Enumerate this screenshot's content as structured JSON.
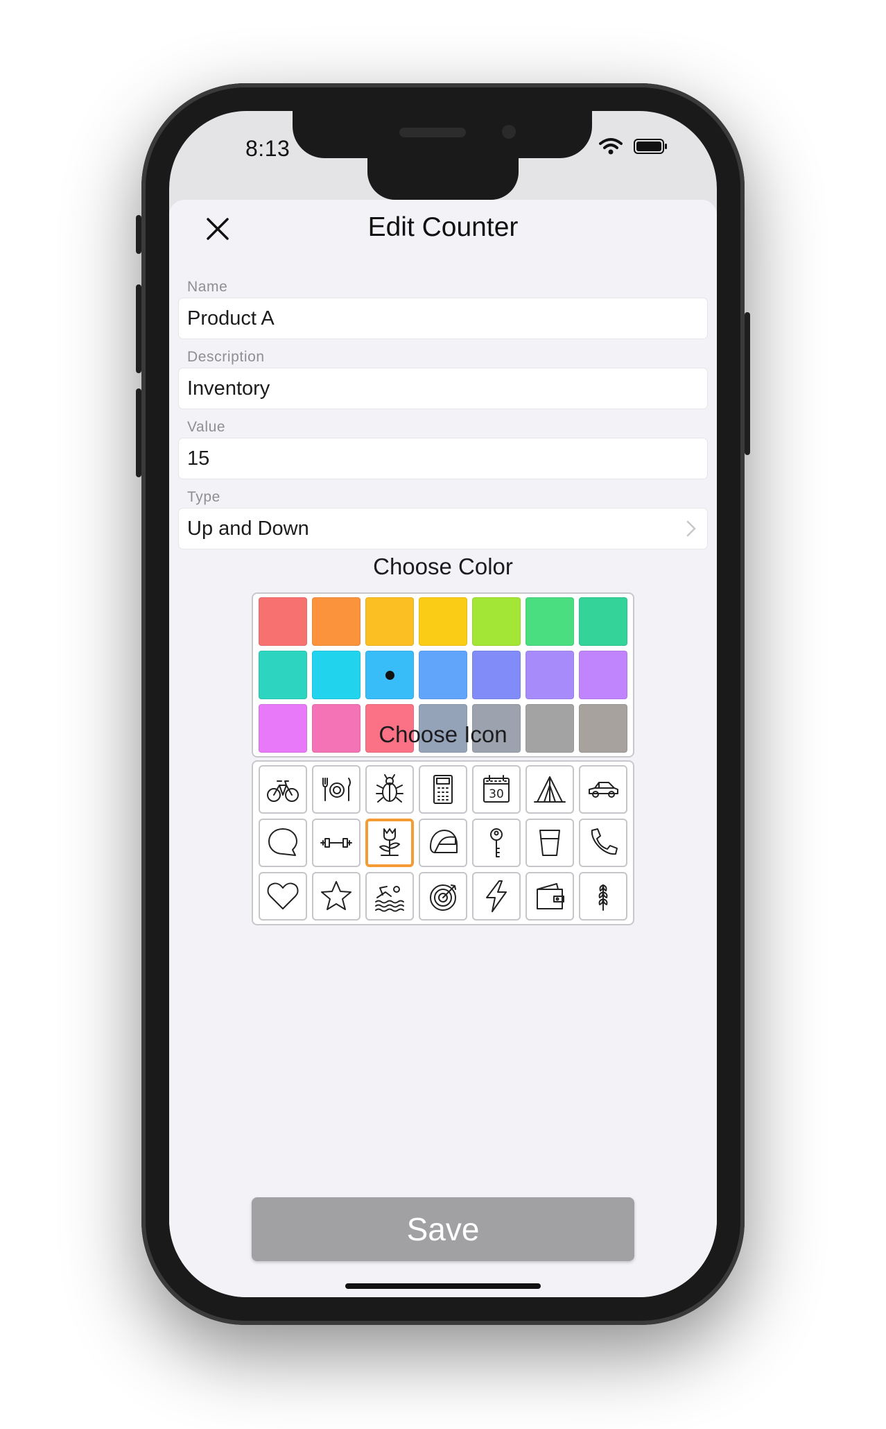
{
  "status_bar": {
    "time": "8:13",
    "signal_icon": "signal-dots-icon",
    "wifi_icon": "wifi-icon",
    "battery_icon": "battery-icon"
  },
  "header": {
    "title": "Edit Counter",
    "close_icon": "close-icon"
  },
  "form": {
    "name": {
      "label": "Name",
      "value": "Product A"
    },
    "description": {
      "label": "Description",
      "value": "Inventory"
    },
    "value": {
      "label": "Value",
      "value": "15"
    },
    "type": {
      "label": "Type",
      "value": "Up and Down"
    }
  },
  "color_picker": {
    "title": "Choose Color",
    "selected_index": 9,
    "colors": [
      "#f87171",
      "#fb923c",
      "#fbbf24",
      "#facc15",
      "#a3e635",
      "#4ade80",
      "#34d399",
      "#2dd4bf",
      "#22d3ee",
      "#38bdf8",
      "#60a5fa",
      "#818cf8",
      "#a78bfa",
      "#c084fc",
      "#e879f9",
      "#f472b6",
      "#fb7185",
      "#94a3b8",
      "#9ca3af",
      "#a3a3a3",
      "#a8a29e"
    ]
  },
  "icon_picker": {
    "title": "Choose Icon",
    "selected_index": 9,
    "selected_color": "#f39c34",
    "icons": [
      "bicycle-icon",
      "dining-icon",
      "bug-icon",
      "calculator-icon",
      "calendar-icon",
      "tent-icon",
      "car-icon",
      "chat-bubble-icon",
      "dumbbell-icon",
      "flower-icon",
      "helmet-icon",
      "key-icon",
      "glass-icon",
      "phone-icon",
      "heart-icon",
      "star-icon",
      "swimming-icon",
      "target-icon",
      "lightning-icon",
      "wallet-icon",
      "wheat-icon"
    ],
    "calendar_day": "30"
  },
  "actions": {
    "save_label": "Save",
    "save_color": "#a1a1a3"
  }
}
